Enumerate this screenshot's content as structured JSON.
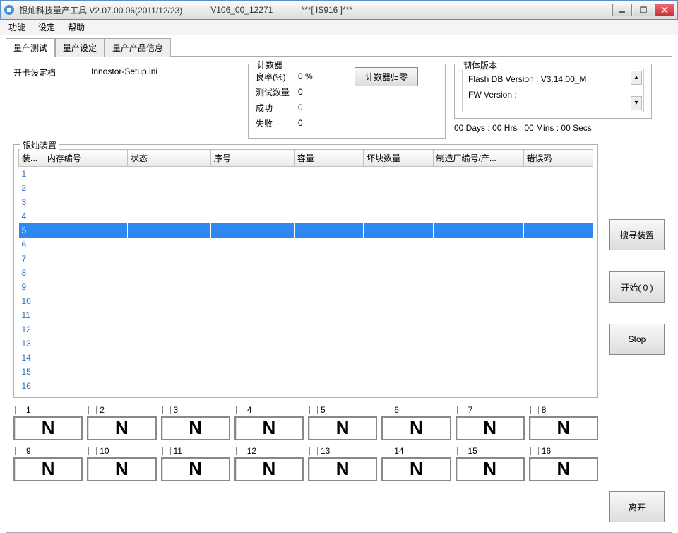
{
  "window": {
    "title_main": "银灿科技量产工具 V2.07.00.06(2011/12/23)",
    "title_mid": "V106_00_12271",
    "title_suffix": "***[ IS916 ]***"
  },
  "menu": {
    "items": [
      "功能",
      "设定",
      "帮助"
    ]
  },
  "tabs": {
    "items": [
      "量产测试",
      "量产设定",
      "量产产品信息"
    ],
    "active": 0
  },
  "setup": {
    "label": "开卡设定档",
    "filename": "Innostor-Setup.ini"
  },
  "counter": {
    "legend": "计数器",
    "reset_btn": "计数器归零",
    "rate_k": "良率(%)",
    "rate_v": "0 %",
    "tested_k": "测试数量",
    "tested_v": "0",
    "ok_k": "成功",
    "ok_v": "0",
    "fail_k": "失败",
    "fail_v": "0"
  },
  "firmware": {
    "legend": "韧体版本",
    "flash_db": "Flash DB Version :  V3.14.00_M",
    "fw_ver": "FW Version :",
    "uptime": "00 Days : 00 Hrs : 00 Mins : 00 Secs"
  },
  "device_table": {
    "legend": "银灿装置",
    "headers": [
      "装...",
      "内存编号",
      "状态",
      "序号",
      "容量",
      "坏块数量",
      "制造厂编号/产...",
      "错误码"
    ],
    "rows": 16,
    "selected_row": 5
  },
  "slots": {
    "count": 16,
    "status_glyph": "N"
  },
  "buttons": {
    "scan": "搜寻装置",
    "start": "开始( 0 )",
    "stop": "Stop",
    "exit": "离开"
  }
}
